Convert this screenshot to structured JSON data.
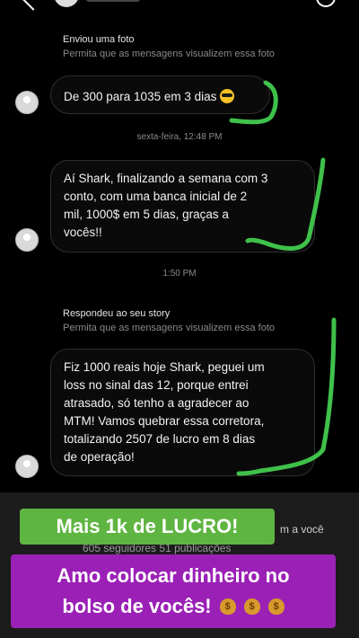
{
  "messages": [
    {
      "meta_title": "Enviou uma foto",
      "meta_sub": "Permita que as mensagens visualizem essa foto",
      "text": "De 300 para 1035 em 3 dias"
    },
    {
      "timestamp": "sexta-feira, 12:48 PM",
      "text_lines": [
        "Aí Shark, finalizando a semana com 3",
        "conto, com uma banca inicial de 2",
        "mil, 1000$ em 5 dias, graças a",
        "vocês!!"
      ]
    },
    {
      "timestamp": "1:50 PM",
      "meta_title": "Respondeu ao seu story",
      "meta_sub": "Permita que as mensagens visualizem essa foto",
      "text_lines": [
        "Fiz 1000 reais hoje Shark, peguei um",
        "loss no sinal das 12, porque entrei",
        "atrasado, só tenho a agradecer ao",
        "MTM! Vamos quebrar essa corretora,",
        "totalizando 2507 de lucro em 8 dias",
        "de operação!"
      ]
    }
  ],
  "profile_strip": {
    "right_text": "m a você",
    "stats_text": "605 seguidores 51 publicações"
  },
  "captions": {
    "green": "Mais 1k de LUCRO!",
    "purple_line1": "Amo colocar dinheiro no",
    "purple_line2": "bolso de vocês!"
  },
  "colors": {
    "annotation": "#3fc14a",
    "caption_green": "#5fb541",
    "caption_purple": "#9b20b6"
  },
  "icons": {
    "emoji_msg1": "sunglasses-face-icon",
    "caption_emojis": [
      "money-bag-icon",
      "money-bag-icon",
      "money-bag-icon"
    ]
  }
}
